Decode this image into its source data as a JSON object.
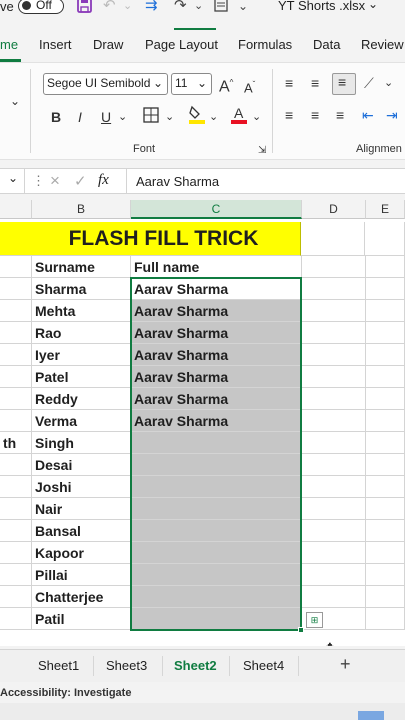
{
  "titlebar": {
    "autosave_label": "ve",
    "autosave_toggle_state": "Off",
    "file_title": "YT Shorts .xlsx",
    "title_chevron": "⌄"
  },
  "menu": {
    "tabs": [
      "me",
      "Insert",
      "Draw",
      "Page Layout",
      "Formulas",
      "Data",
      "Review"
    ]
  },
  "ribbon": {
    "font_name": "Segoe UI Semibold",
    "font_size": "11",
    "grow_font": "A",
    "shrink_font": "A",
    "bold": "B",
    "italic": "I",
    "underline": "U",
    "group_font_label": "Font",
    "group_alignment_label": "Alignmen",
    "accent_yellow": "#ffe600",
    "accent_red": "#e81123"
  },
  "formula_bar": {
    "cancel_glyph": "×",
    "enter_glyph": "✓",
    "fx_label": "fx",
    "content": "Aarav Sharma"
  },
  "grid": {
    "column_headers": [
      "B",
      "C",
      "D",
      "E"
    ],
    "banner_text": "FLASH FILL TRICK",
    "header_row": {
      "b": "Surname",
      "c": "Full name"
    },
    "rows": [
      {
        "a": "",
        "b": "Sharma",
        "c": "Aarav Sharma"
      },
      {
        "a": "",
        "b": "Mehta",
        "c": "Aarav Sharma"
      },
      {
        "a": "",
        "b": "Rao",
        "c": "Aarav Sharma"
      },
      {
        "a": "",
        "b": "Iyer",
        "c": "Aarav Sharma"
      },
      {
        "a": "",
        "b": "Patel",
        "c": "Aarav Sharma"
      },
      {
        "a": "",
        "b": "Reddy",
        "c": "Aarav Sharma"
      },
      {
        "a": "",
        "b": "Verma",
        "c": "Aarav Sharma"
      },
      {
        "a": "th",
        "b": "Singh",
        "c": ""
      },
      {
        "a": "",
        "b": "Desai",
        "c": ""
      },
      {
        "a": "",
        "b": "Joshi",
        "c": ""
      },
      {
        "a": "",
        "b": "Nair",
        "c": ""
      },
      {
        "a": "",
        "b": "Bansal",
        "c": ""
      },
      {
        "a": "",
        "b": "Kapoor",
        "c": ""
      },
      {
        "a": "",
        "b": "Pillai",
        "c": ""
      },
      {
        "a": "",
        "b": "Chatterjee",
        "c": ""
      },
      {
        "a": "",
        "b": "Patil",
        "c": ""
      }
    ],
    "banner_color": "#ffff00",
    "selection_color": "#107c41"
  },
  "sheets": {
    "tabs": [
      "Sheet1",
      "Sheet3",
      "Sheet2",
      "Sheet4"
    ],
    "active": "Sheet2",
    "add_glyph": "+"
  },
  "status": {
    "accessibility": "Accessibility: Investigate"
  }
}
